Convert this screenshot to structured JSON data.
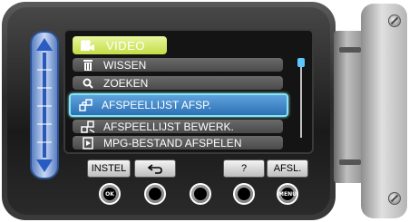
{
  "menu": {
    "header": {
      "icon": "video-camera-icon",
      "label": "VIDEO"
    },
    "items": [
      {
        "icon": "trash-icon",
        "label": "WISSEN"
      },
      {
        "icon": "magnifier-icon",
        "label": "ZOEKEN"
      },
      {
        "icon": "playlist-icon",
        "label": "AFSPEELLIJST AFSP."
      },
      {
        "icon": "playlist-edit-icon",
        "label": "AFSPEELLIJST BEWERK."
      },
      {
        "icon": "mpg-play-icon",
        "label": "MPG-BESTAND AFSPELEN"
      }
    ],
    "selected_index": 2
  },
  "softkeys": {
    "settings": "INSTEL",
    "back": "⮌",
    "help": "?",
    "exit": "AFSL."
  },
  "buttons": {
    "ok_label": "OK",
    "menu_label": "MENU"
  },
  "colors": {
    "header_bg": "#c3dd45",
    "selected_bg": "#2d6fb5",
    "selected_border": "#86e3f3",
    "slider_blue": "#2a5bc0"
  }
}
